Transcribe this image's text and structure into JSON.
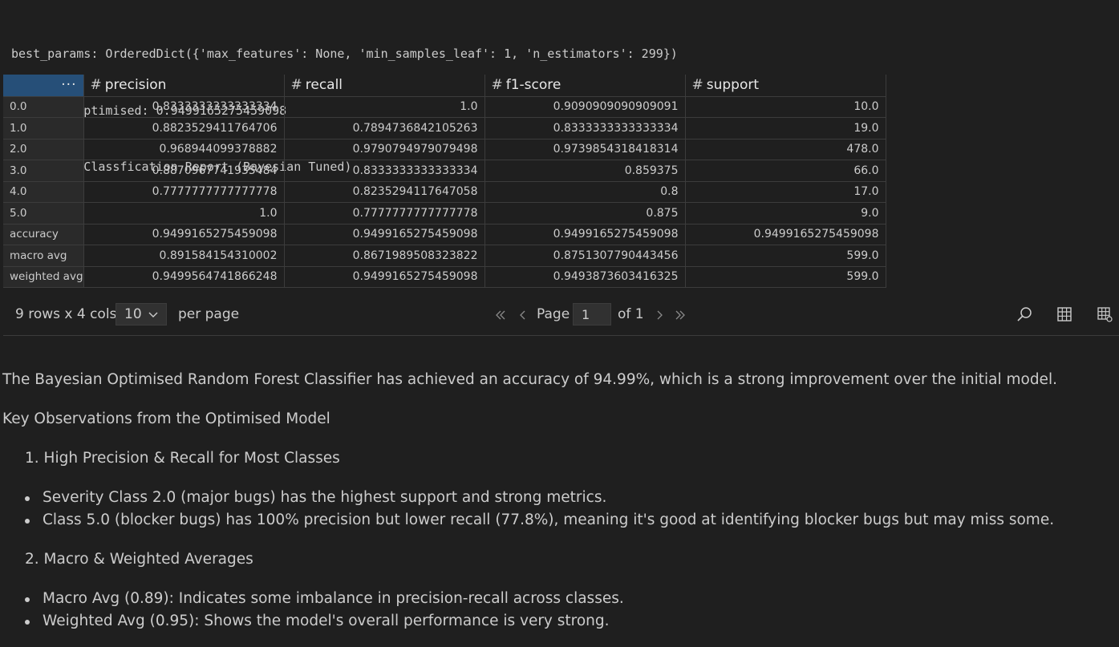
{
  "output": {
    "lines": [
      "best_params: OrderedDict({'max_features': None, 'min_samples_leaf': 1, 'n_estimators': 299})",
      "accuracy_optimised: 0.9499165275459098",
      "Optimised Classfication Report (Bayesian Tuned)"
    ]
  },
  "grid": {
    "index_header": "···",
    "type_icon": "#",
    "columns": [
      "precision",
      "recall",
      "f1-score",
      "support"
    ],
    "rows": [
      {
        "index": "0.0",
        "cells": [
          "0.8333333333333334",
          "1.0",
          "0.9090909090909091",
          "10.0"
        ]
      },
      {
        "index": "1.0",
        "cells": [
          "0.8823529411764706",
          "0.7894736842105263",
          "0.8333333333333334",
          "19.0"
        ]
      },
      {
        "index": "2.0",
        "cells": [
          "0.968944099378882",
          "0.9790794979079498",
          "0.9739854318418314",
          "478.0"
        ]
      },
      {
        "index": "3.0",
        "cells": [
          "0.8870967741935484",
          "0.8333333333333334",
          "0.859375",
          "66.0"
        ]
      },
      {
        "index": "4.0",
        "cells": [
          "0.7777777777777778",
          "0.8235294117647058",
          "0.8",
          "17.0"
        ]
      },
      {
        "index": "5.0",
        "cells": [
          "1.0",
          "0.7777777777777778",
          "0.875",
          "9.0"
        ]
      },
      {
        "index": "accuracy",
        "cells": [
          "0.9499165275459098",
          "0.9499165275459098",
          "0.9499165275459098",
          "0.9499165275459098"
        ]
      },
      {
        "index": "macro avg",
        "cells": [
          "0.891584154310002",
          "0.8671989508323822",
          "0.8751307790443456",
          "599.0"
        ]
      },
      {
        "index": "weighted avg",
        "cells": [
          "0.9499564741866248",
          "0.9499165275459098",
          "0.9493873603416325",
          "599.0"
        ]
      }
    ]
  },
  "pager": {
    "rows_cols": "9 rows x 4 cols",
    "per_page_value": "10",
    "per_page_label": "per page",
    "page_label": "Page",
    "page_value": "1",
    "of_label": "of 1",
    "icons": [
      "first-page-icon",
      "prev-page-icon",
      "next-page-icon",
      "last-page-icon",
      "search-icon",
      "table-icon",
      "column-settings-icon"
    ]
  },
  "markdown": {
    "summary": "The Bayesian Optimised Random Forest Classifier has achieved an accuracy of 94.99%, which is a strong improvement over the initial model.",
    "heading": "Key Observations from the Optimised Model",
    "section1_title": "1. High Precision & Recall for Most Classes",
    "section1_bullets": [
      "Severity Class 2.0 (major bugs) has the highest support and strong metrics.",
      "Class 5.0 (blocker bugs) has 100% precision but lower recall (77.8%), meaning it's good at identifying blocker bugs but may miss some."
    ],
    "section2_title": "2. Macro & Weighted Averages",
    "section2_bullets": [
      "Macro Avg (0.89): Indicates some imbalance in precision-recall across classes.",
      "Weighted Avg (0.95): Shows the model's overall performance is very strong."
    ]
  },
  "colors": {
    "background": "#1f1f1f",
    "index_header_bg": "#264f78",
    "text": "#cccccc",
    "border": "#3c3c3c"
  }
}
